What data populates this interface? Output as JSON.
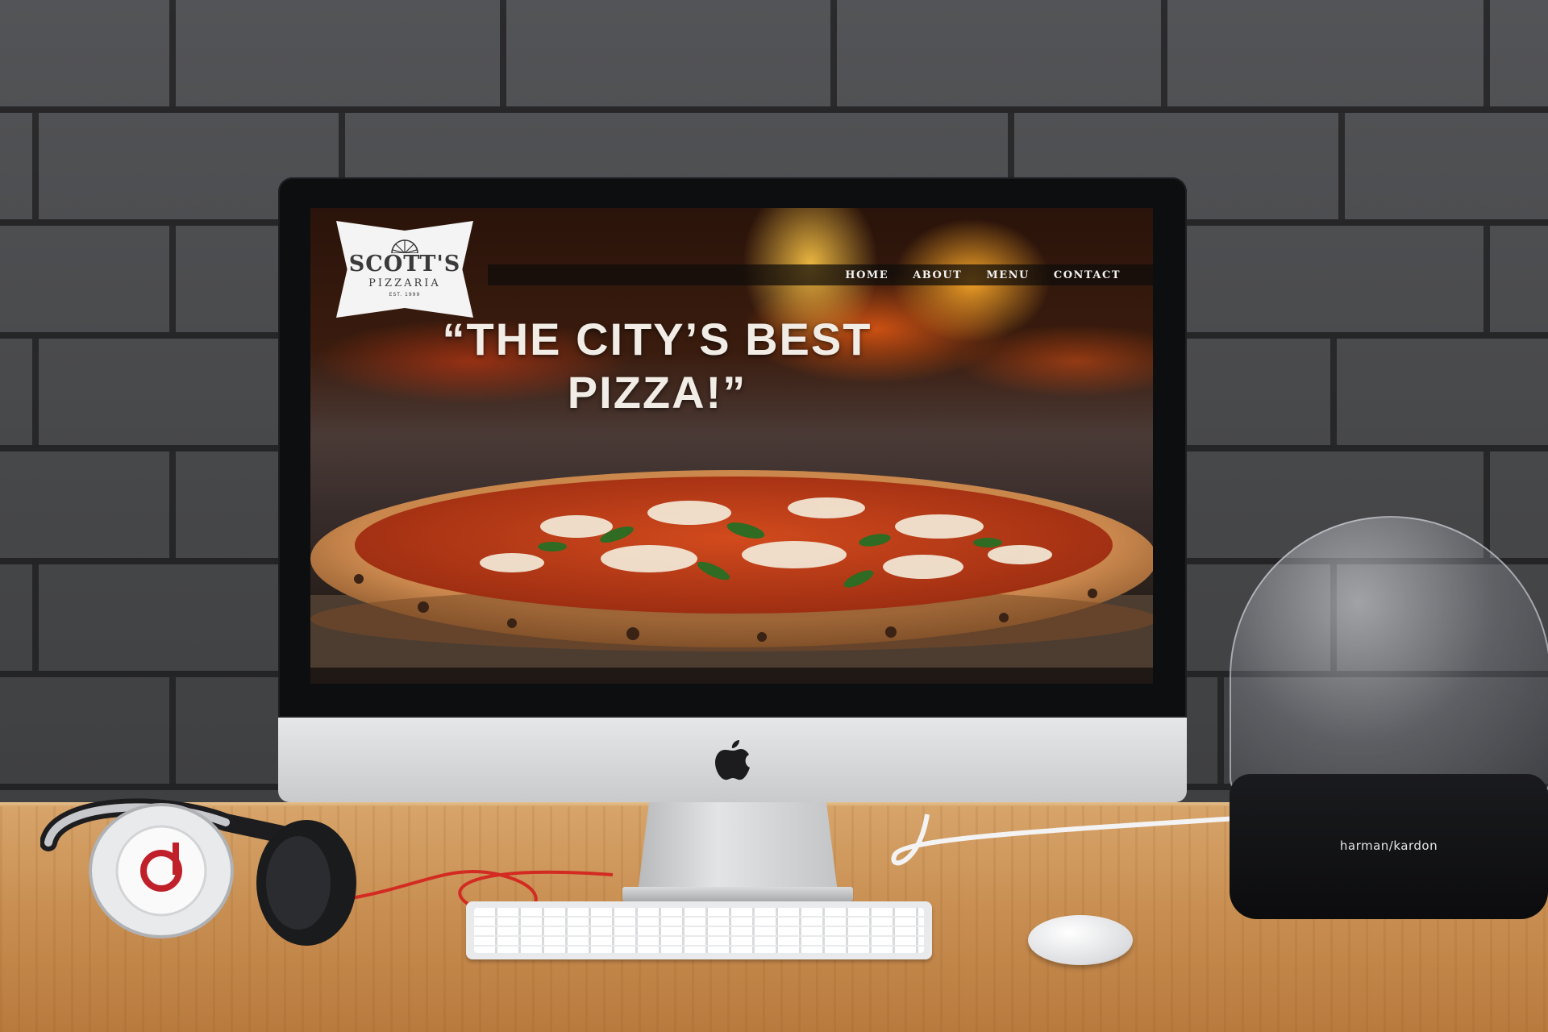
{
  "website": {
    "logo": {
      "name": "SCOTT'S",
      "sub": "PIZZARIA",
      "est": "EST. 1999"
    },
    "nav": {
      "items": [
        "HOME",
        "ABOUT",
        "MENU",
        "CONTACT"
      ]
    },
    "hero": {
      "headline_line1": "“THE CITY’S BEST",
      "headline_line2": "PIZZA!”"
    }
  },
  "devices": {
    "speaker_brand": "harman/kardon"
  },
  "colors": {
    "nav_bg": "#0f0c0a",
    "headline": "#f1ece5",
    "logo_bg": "#f4f4f4",
    "fire": "#ff9a1f"
  },
  "icons": {
    "apple_logo": "apple-logo-icon",
    "logo_wheel": "pizza-wheel-icon"
  }
}
